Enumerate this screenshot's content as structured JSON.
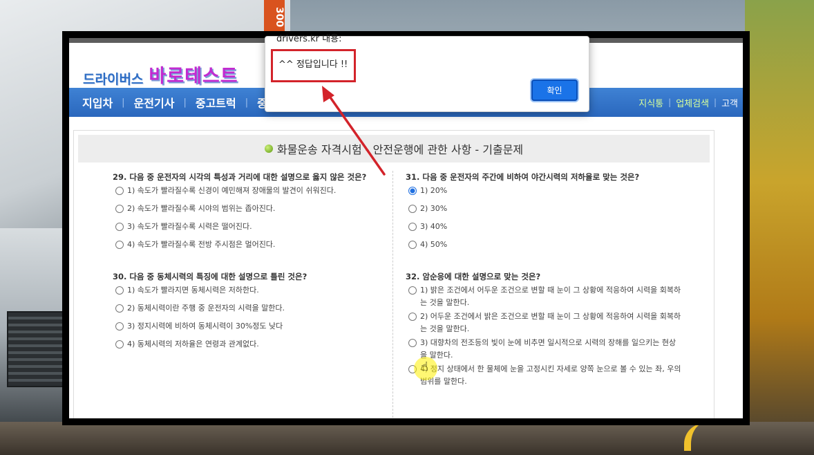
{
  "background": {
    "sticker_text": "300"
  },
  "site": {
    "logo_small": "드라이버스",
    "logo_big": "바로테스트"
  },
  "nav": {
    "items": [
      "지입차",
      "운전기사",
      "중고트럭",
      "중"
    ],
    "right_links": [
      "지식통",
      "업체검색",
      "고객"
    ]
  },
  "page_title": "화물운송 자격시험 - 안전운행에 관한 사항 - 기출문제",
  "questions": {
    "q29": {
      "text": "29. 다음 중 운전자의 시각의 특성과 거리에 대한 설명으로 옳지 않은 것은?",
      "options": [
        "1) 속도가 빨라질수록 신경이 예민해져 장애물의 발견이 쉬워진다.",
        "2) 속도가 빨라질수록 시야의 범위는 좁아진다.",
        "3) 속도가 빨라질수록 시력은 떨어진다.",
        "4) 속도가 빨라질수록 전방 주시점은 멀어진다."
      ]
    },
    "q30": {
      "text": "30. 다음 중 동체시력의 특징에 대한 설명으로 틀린 것은?",
      "options": [
        "1) 속도가 빨라지면 동체시력은 저하한다.",
        "2) 동체시력이란 주행 중 운전자의 시력을 말한다.",
        "3) 정지시력에 비하여 동체시력이 30%정도 낮다",
        "4) 동체시력의 저하율은 연령과 관계없다."
      ]
    },
    "q31": {
      "text": "31. 다음 중 운전자의 주간에 비하여 야간시력의 저하율로 맞는 것은?",
      "options": [
        "1) 20%",
        "2) 30%",
        "3) 40%",
        "4) 50%"
      ],
      "selected_index": 0
    },
    "q32": {
      "text": "32. 암순응에 대한 설명으로 맞는 것은?",
      "options": [
        "1) 밝은 조건에서 어두운 조건으로 변할 때 눈이 그 상황에 적응하여 시력을 회복하는 것을 말한다.",
        "2) 어두운 조건에서 밝은 조건으로 변할 때 눈이 그 상황에 적응하여 시력을 회복하는 것을 말한다.",
        "3) 대향차의 전조등의 빛이 눈에 비추면 일시적으로 시력의 장해를 일으키는 현상을 말한다.",
        "4) 정지 상태에서 한 물체에 눈을 고정시킨 자세로 양쪽 눈으로 볼 수 있는 좌, 우의 범위를 말한다."
      ]
    }
  },
  "alert": {
    "title": "drivers.kr 내용:",
    "message": "^^ 정답입니다 !!",
    "ok_label": "확인"
  },
  "colors": {
    "nav_blue": "#2f6fc6",
    "highlight_red": "#d3232a",
    "button_blue": "#1a73e8"
  }
}
